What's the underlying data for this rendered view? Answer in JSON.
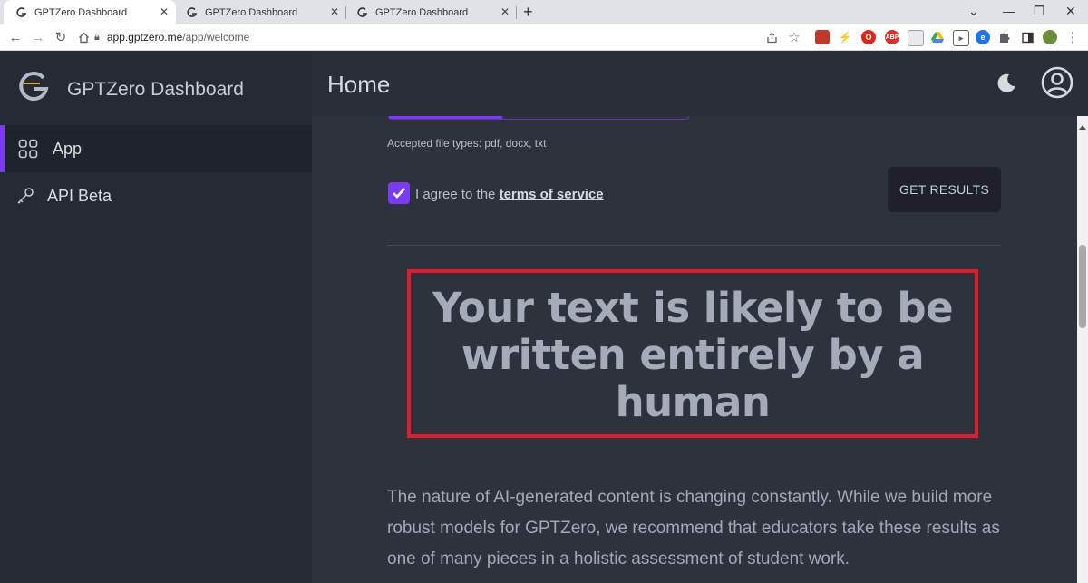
{
  "browser": {
    "tabs": [
      {
        "title": "GPTZero Dashboard",
        "active": true
      },
      {
        "title": "GPTZero Dashboard",
        "active": false
      },
      {
        "title": "GPTZero Dashboard",
        "active": false
      }
    ],
    "url_host": "app.gptzero.me",
    "url_path": "/app/welcome"
  },
  "sidebar": {
    "brand": "GPTZero Dashboard",
    "items": [
      {
        "label": "App",
        "icon": "grid-icon",
        "active": true
      },
      {
        "label": "API Beta",
        "icon": "key-icon",
        "active": false
      }
    ]
  },
  "header": {
    "title": "Home"
  },
  "upload": {
    "accepted_types": "Accepted file types: pdf, docx, txt",
    "agree_prefix": "I agree to the",
    "terms_link": "terms of service",
    "agree_checked": true,
    "submit_label": "GET RESULTS"
  },
  "result": {
    "verdict": "Your text is likely to be written entirely by a human"
  },
  "disclaimer": "The nature of AI-generated content is changing constantly. While we build more robust models for GPTZero, we recommend that educators take these results as one of many pieces in a holistic assessment of student work.",
  "colors": {
    "accent": "#7a3cf3",
    "highlight": "#e11d2b",
    "sidebar_bg": "#262a35",
    "main_bg": "#2e323d"
  }
}
